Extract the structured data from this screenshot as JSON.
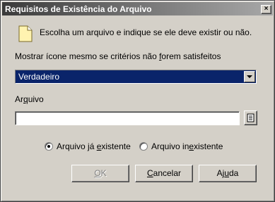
{
  "window": {
    "title": "Requisitos de Existência do Arquivo",
    "close_glyph": "×"
  },
  "intro": {
    "icon": "document-icon",
    "text": "Escolha um arquivo e indique se ele deve existir ou não."
  },
  "show_icon": {
    "label_before": "Mostrar ícone mesmo se critérios não ",
    "label_accel": "f",
    "label_after": "orem satisfeitos",
    "selected_value": "Verdadeiro"
  },
  "file": {
    "label_before": "Ar",
    "label_accel": "q",
    "label_after": "uivo",
    "value": "",
    "browse_icon": "browse-icon"
  },
  "existence": {
    "options": [
      {
        "before": "Arquivo já ",
        "accel": "e",
        "after": "xistente",
        "checked": true
      },
      {
        "before": "Arquivo in",
        "accel": "e",
        "after": "xistente",
        "checked": false
      }
    ]
  },
  "buttons": {
    "ok": {
      "accel": "O",
      "rest": "K",
      "enabled": false
    },
    "cancel": {
      "accel": "C",
      "rest": "ancelar"
    },
    "help": {
      "before": "Aj",
      "accel": "u",
      "after": "da"
    }
  }
}
